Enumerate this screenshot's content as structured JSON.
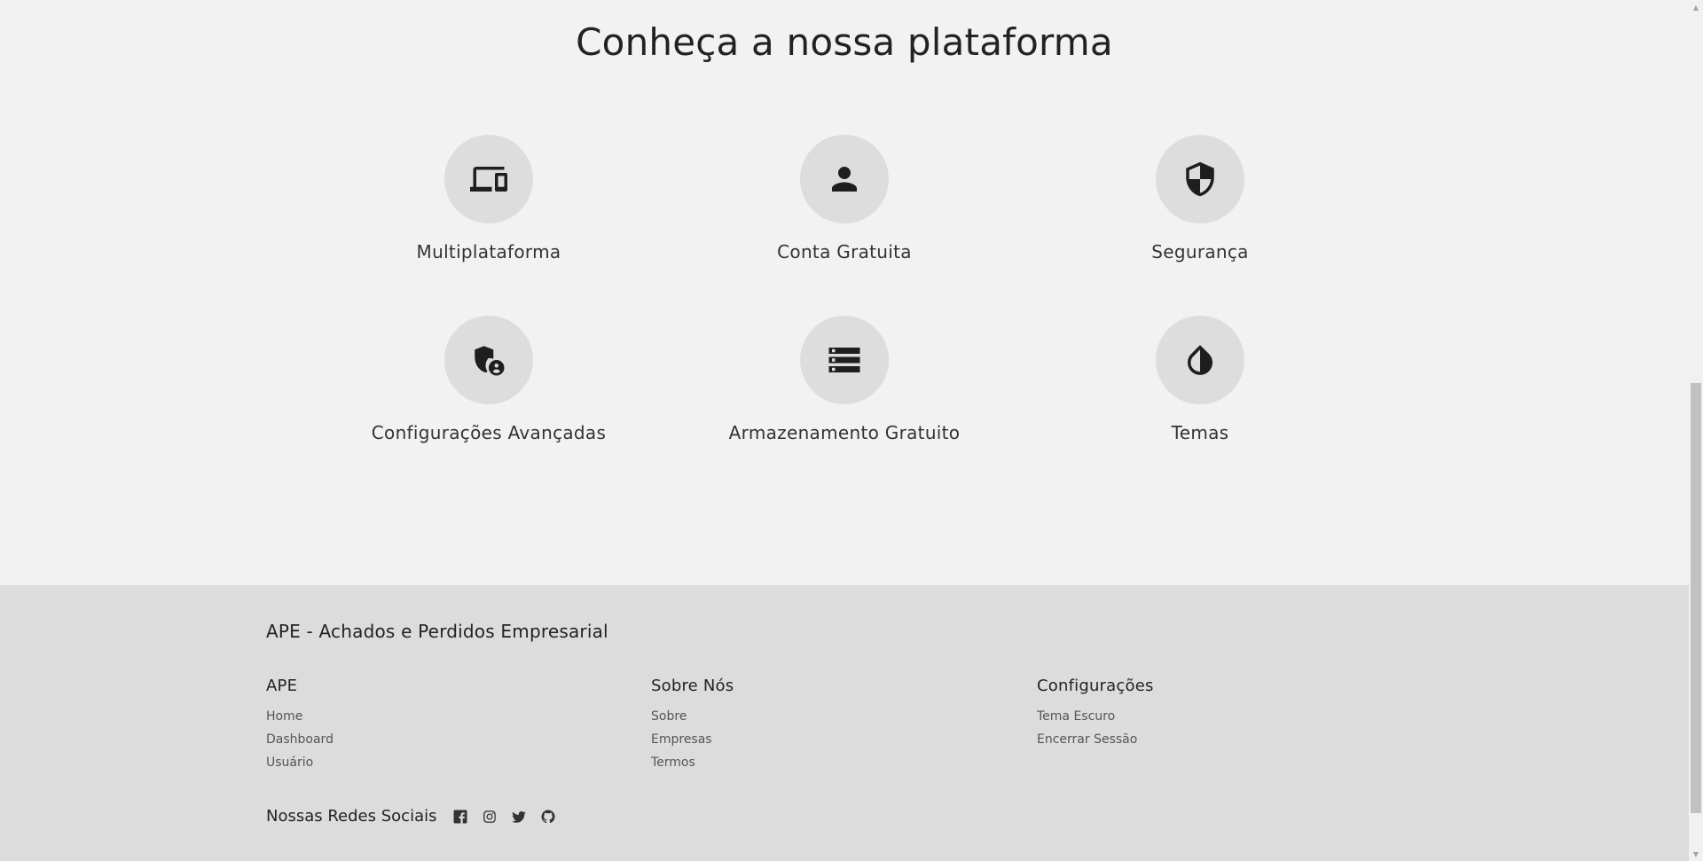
{
  "page": {
    "title": "Conheça a nossa plataforma"
  },
  "features": [
    {
      "label": "Multiplataforma",
      "icon": "devices-icon"
    },
    {
      "label": "Conta Gratuita",
      "icon": "person-icon"
    },
    {
      "label": "Segurança",
      "icon": "security-shield-icon"
    },
    {
      "label": "Configurações Avançadas",
      "icon": "admin-shield-icon"
    },
    {
      "label": "Armazenamento Gratuito",
      "icon": "storage-icon"
    },
    {
      "label": "Temas",
      "icon": "contrast-drop-icon"
    }
  ],
  "footer": {
    "brand": "APE - Achados e Perdidos Empresarial",
    "columns": [
      {
        "title": "APE",
        "links": [
          "Home",
          "Dashboard",
          "Usuário"
        ]
      },
      {
        "title": "Sobre Nós",
        "links": [
          "Sobre",
          "Empresas",
          "Termos"
        ]
      },
      {
        "title": "Configurações",
        "links": [
          "Tema Escuro",
          "Encerrar Sessão"
        ]
      }
    ],
    "social_label": "Nossas Redes Sociais",
    "social_icons": [
      "facebook-icon",
      "instagram-icon",
      "twitter-icon",
      "github-icon"
    ]
  },
  "colors": {
    "background": "#f2f2f2",
    "footer_background": "#dcdcdc",
    "icon_circle": "#dddddd",
    "icon_fill": "#1e1e1e"
  }
}
